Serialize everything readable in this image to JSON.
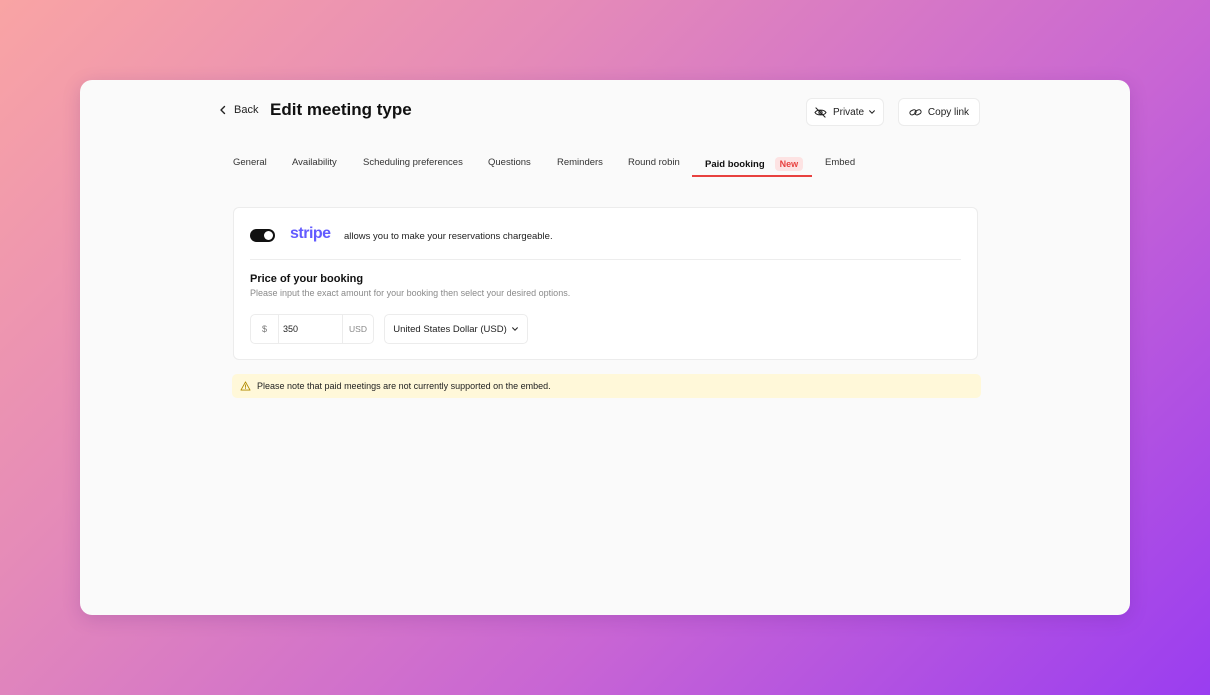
{
  "header": {
    "back_label": "Back",
    "title": "Edit meeting type",
    "visibility_label": "Private",
    "copy_link_label": "Copy link"
  },
  "tabs": [
    {
      "label": "General",
      "active": false
    },
    {
      "label": "Availability",
      "active": false
    },
    {
      "label": "Scheduling preferences",
      "active": false
    },
    {
      "label": "Questions",
      "active": false
    },
    {
      "label": "Reminders",
      "active": false
    },
    {
      "label": "Round robin",
      "active": false
    },
    {
      "label": "Paid booking",
      "active": true,
      "badge": "New"
    },
    {
      "label": "Embed",
      "active": false
    }
  ],
  "stripe": {
    "enabled": true,
    "logo_text": "stripe",
    "description": "allows you to make your reservations chargeable."
  },
  "price": {
    "title": "Price of your booking",
    "description": "Please input the exact amount for your booking then select your desired options.",
    "currency_symbol": "$",
    "amount": "350",
    "unit": "USD",
    "currency_selected": "United States Dollar (USD)"
  },
  "notice": {
    "text": "Please note that paid meetings are not currently supported on the embed."
  },
  "colors": {
    "accent": "#e8413f",
    "stripe_brand": "#635bff",
    "notice_bg": "#fff8d9"
  }
}
